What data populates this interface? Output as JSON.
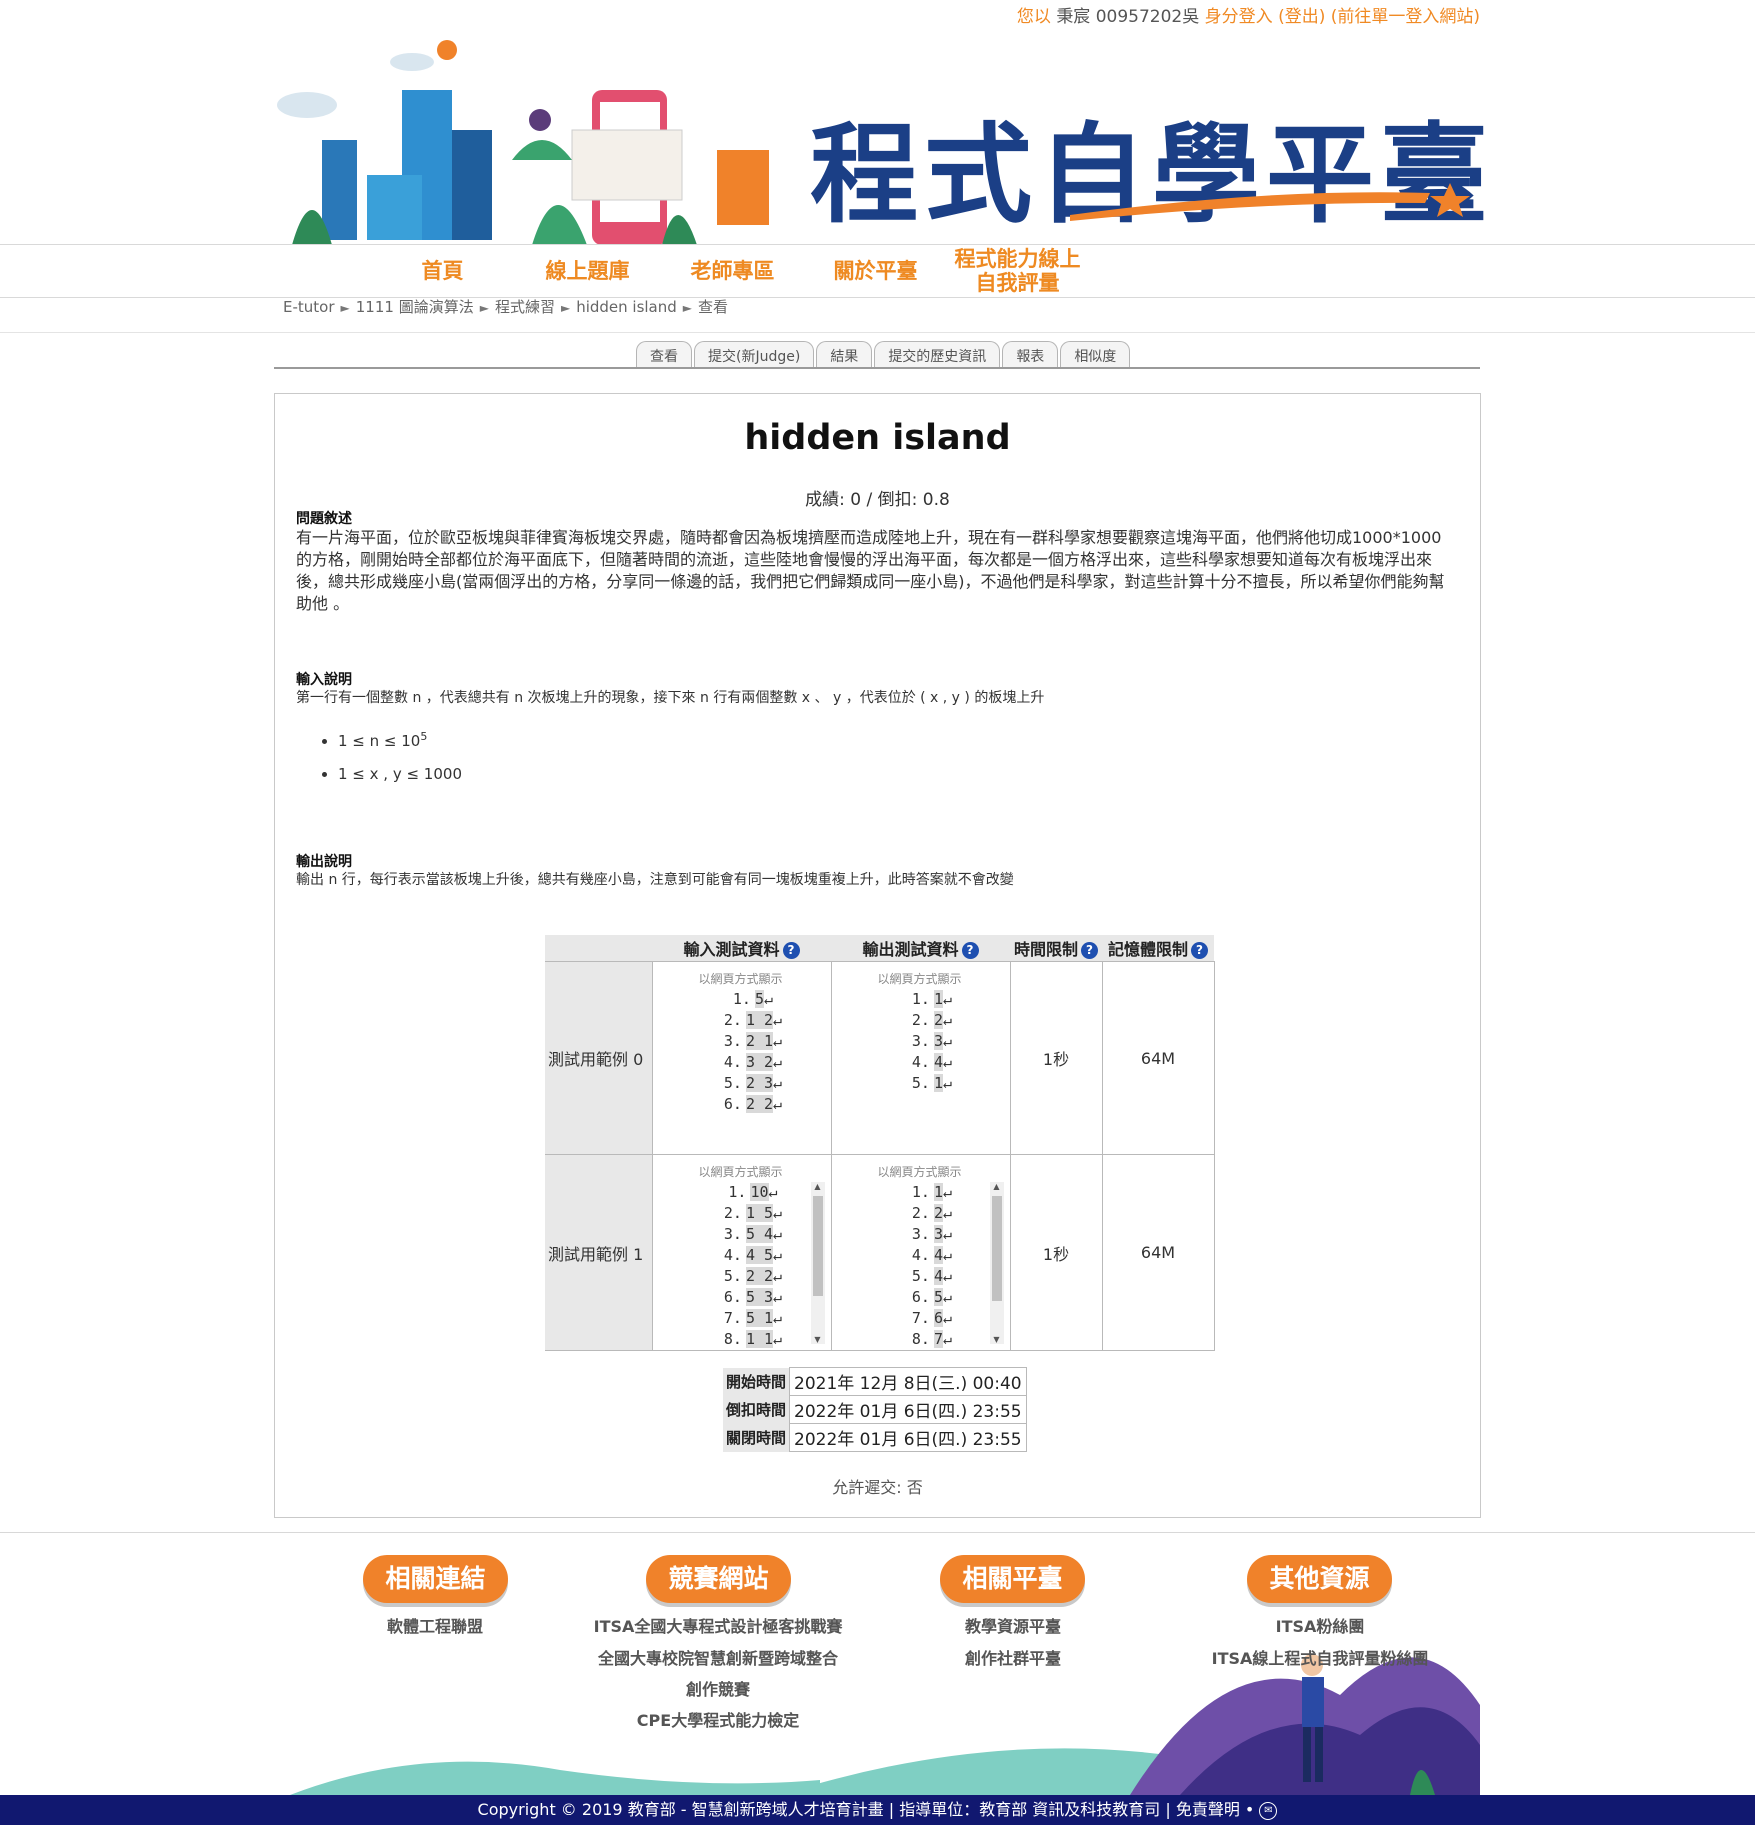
{
  "header": {
    "greeting": "您以",
    "user_name": "秉宸 00957202吳",
    "login_role": "身分登入",
    "logout_label": "(登出)",
    "sso_label": "(前往單一登入網站)",
    "site_title": "程式自學平臺"
  },
  "nav": {
    "items": [
      "首頁",
      "線上題庫",
      "老師專區",
      "關於平臺",
      "程式能力線上自我評量"
    ]
  },
  "breadcrumb": [
    "E-tutor",
    "1111 圖論演算法",
    "程式練習",
    "hidden island",
    "查看"
  ],
  "tabs": [
    "查看",
    "提交(新Judge)",
    "結果",
    "提交的歷史資訊",
    "報表",
    "相似度"
  ],
  "problem": {
    "title": "hidden island",
    "score_line": "成績: 0 / 倒扣: 0.8",
    "desc_heading": "問題敘述",
    "desc_text": "有一片海平面，位於歐亞板塊與菲律賓海板塊交界處，隨時都會因為板塊擠壓而造成陸地上升，現在有一群科學家想要觀察這塊海平面，他們將他切成1000*1000 的方格，剛開始時全部都位於海平面底下，但隨著時間的流逝，這些陸地會慢慢的浮出海平面，每次都是一個方格浮出來，這些科學家想要知道每次有板塊浮出來後，總共形成幾座小島(當兩個浮出的方格，分享同一條邊的話，我們把它們歸類成同一座小島)，不過他們是科學家，對這些計算十分不擅長，所以希望你們能夠幫助他 。",
    "input_heading": "輸入說明",
    "input_text": "第一行有一個整數 n ，代表總共有 n 次板塊上升的現象，接下來 n 行有兩個整數 x 、 y ，代表位於 ( x , y ) 的板塊上升",
    "constraints": [
      "1 ≤ n ≤ 10",
      "1 ≤ x , y ≤ 1000"
    ],
    "constraint_exponent": "5",
    "output_heading": "輸出說明",
    "output_text": "輸出 n 行，每行表示當該板塊上升後，總共有幾座小島，注意到可能會有同一塊板塊重複上升，此時答案就不會改變"
  },
  "samples": {
    "headers": [
      "輸入測試資料",
      "輸出測試資料",
      "時間限制",
      "記憶體限制"
    ],
    "view_label": "以網頁方式顯示",
    "rows": [
      {
        "label": "測試用範例 0",
        "input": [
          "5",
          "1 2",
          "2 1",
          "3 2",
          "2 3",
          "2 2"
        ],
        "output": [
          "1",
          "2",
          "3",
          "4",
          "1"
        ],
        "time": "1秒",
        "memory": "64M"
      },
      {
        "label": "測試用範例 1",
        "input": [
          "10",
          "1 5",
          "5 4",
          "4 5",
          "2 2",
          "5 3",
          "5 1",
          "1 1"
        ],
        "output": [
          "1",
          "2",
          "3",
          "4",
          "4",
          "5",
          "6",
          "7"
        ],
        "time": "1秒",
        "memory": "64M"
      }
    ]
  },
  "schedule": {
    "start_label": "開始時間",
    "start_value": "2021年 12月 8日(三.) 00:40",
    "deduct_label": "倒扣時間",
    "deduct_value": "2022年 01月 6日(四.) 23:55",
    "close_label": "關閉時間",
    "close_value": "2022年 01月 6日(四.) 23:55",
    "resubmit": "允許遲交: 否"
  },
  "footer": {
    "sections": [
      {
        "title": "相關連結",
        "links": [
          "軟體工程聯盟"
        ]
      },
      {
        "title": "競賽網站",
        "links": [
          "ITSA全國大專程式設計極客挑戰賽",
          "全國大專校院智慧創新暨跨域整合",
          "創作競賽",
          "CPE大學程式能力檢定"
        ]
      },
      {
        "title": "相關平臺",
        "links": [
          "教學資源平臺",
          "創作社群平臺"
        ]
      },
      {
        "title": "其他資源",
        "links": [
          "ITSA粉絲團",
          "ITSA線上程式自我評量粉絲團"
        ]
      }
    ],
    "copyright": "Copyright © 2019 教育部 - 智慧創新跨域人才培育計畫 | 指導單位：教育部 資訊及科技教育司 | 免責聲明 •"
  },
  "colors": {
    "brand_orange": "#f0822a",
    "brand_navy": "#1b3f86",
    "footer_bar": "#111870"
  }
}
